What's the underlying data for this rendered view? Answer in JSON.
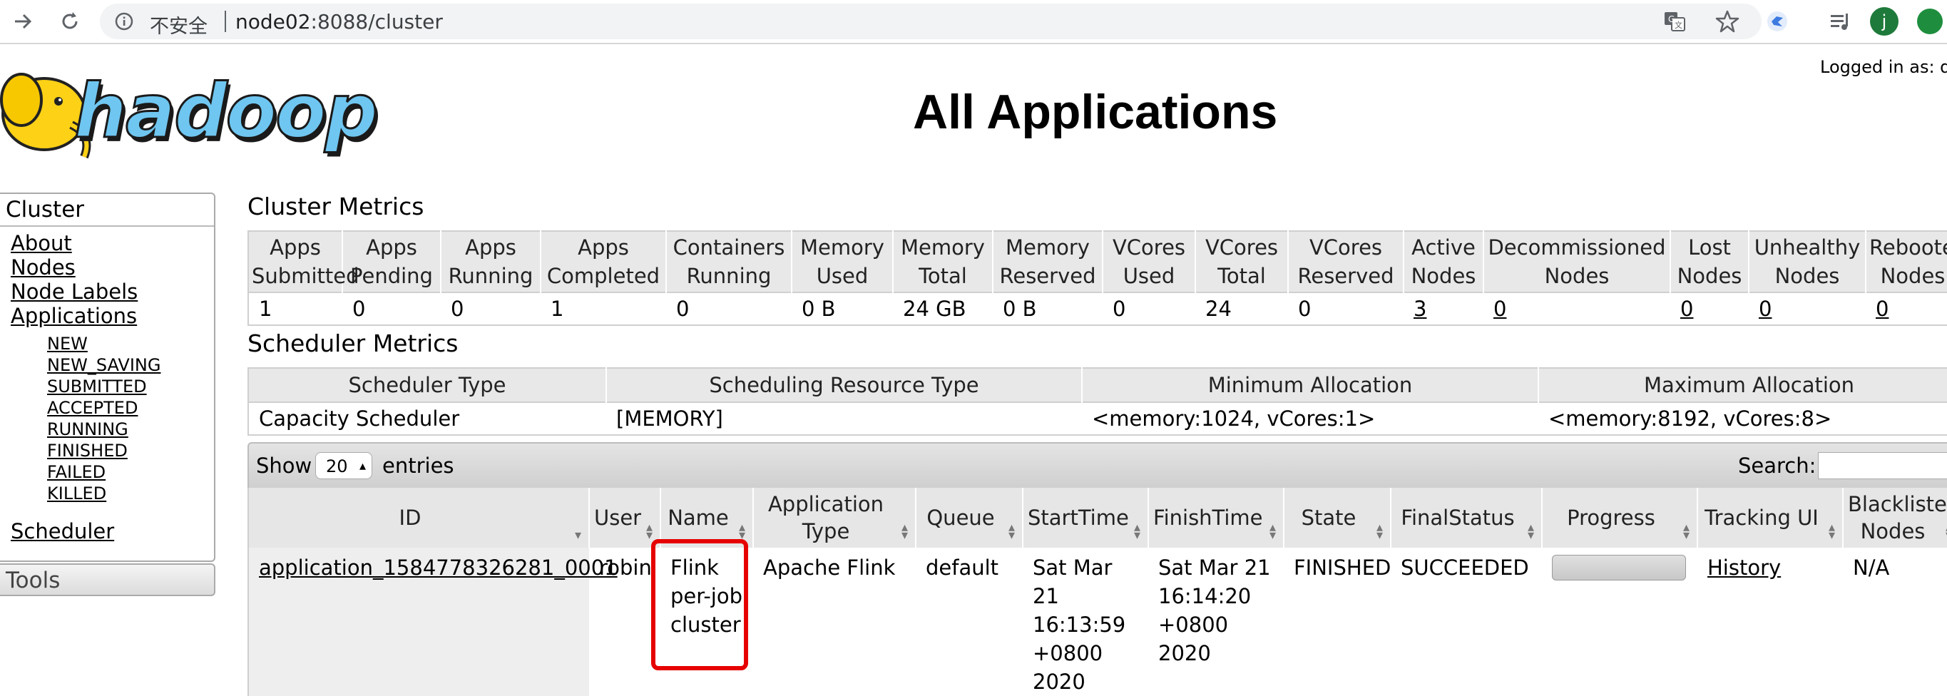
{
  "browser": {
    "insecure_label": "不安全",
    "url_host": "node02",
    "url_rest": ":8088/cluster",
    "avatar_letter": "j"
  },
  "header": {
    "logo_text": "hadoop",
    "title": "All Applications",
    "logged_in": "Logged in as: dr.who"
  },
  "sidebar": {
    "cluster_heading": "Cluster",
    "links": [
      "About",
      "Nodes",
      "Node Labels",
      "Applications"
    ],
    "states": [
      "NEW",
      "NEW_SAVING",
      "SUBMITTED",
      "ACCEPTED",
      "RUNNING",
      "FINISHED",
      "FAILED",
      "KILLED"
    ],
    "scheduler": "Scheduler",
    "tools_heading": "Tools"
  },
  "cluster_metrics": {
    "title": "Cluster Metrics",
    "headers": [
      "Apps Submitted",
      "Apps Pending",
      "Apps Running",
      "Apps Completed",
      "Containers Running",
      "Memory Used",
      "Memory Total",
      "Memory Reserved",
      "VCores Used",
      "VCores Total",
      "VCores Reserved",
      "Active Nodes",
      "Decommissioned Nodes",
      "Lost Nodes",
      "Unhealthy Nodes",
      "Rebooted Nodes"
    ],
    "values": [
      "1",
      "0",
      "0",
      "1",
      "0",
      "0 B",
      "24 GB",
      "0 B",
      "0",
      "24",
      "0",
      "3",
      "0",
      "0",
      "0",
      "0"
    ],
    "linked": [
      false,
      false,
      false,
      false,
      false,
      false,
      false,
      false,
      false,
      false,
      false,
      true,
      true,
      true,
      true,
      true
    ]
  },
  "scheduler_metrics": {
    "title": "Scheduler Metrics",
    "headers": [
      "Scheduler Type",
      "Scheduling Resource Type",
      "Minimum Allocation",
      "Maximum Allocation"
    ],
    "values": [
      "Capacity Scheduler",
      "[MEMORY]",
      "<memory:1024, vCores:1>",
      "<memory:8192, vCores:8>"
    ]
  },
  "apps_table": {
    "show_label": "Show",
    "page_size": "20",
    "entries_label": "entries",
    "search_label": "Search:",
    "headers": [
      "ID",
      "User",
      "Name",
      "Application Type",
      "Queue",
      "StartTime",
      "FinishTime",
      "State",
      "FinalStatus",
      "Progress",
      "Tracking UI",
      "Blacklisted Nodes"
    ],
    "rows": [
      {
        "id": "application_1584778326281_0001",
        "user": "robin",
        "name": "Flink per-job cluster",
        "type": "Apache Flink",
        "queue": "default",
        "start": "Sat Mar 21 16:13:59 +0800 2020",
        "finish": "Sat Mar 21 16:14:20 +0800 2020",
        "state": "FINISHED",
        "final_status": "SUCCEEDED",
        "progress": 1.0,
        "tracking": "History",
        "blacklisted": "N/A"
      }
    ]
  },
  "colors": {
    "highlight": "#e60000",
    "header_bg": "#e8e8e8"
  }
}
